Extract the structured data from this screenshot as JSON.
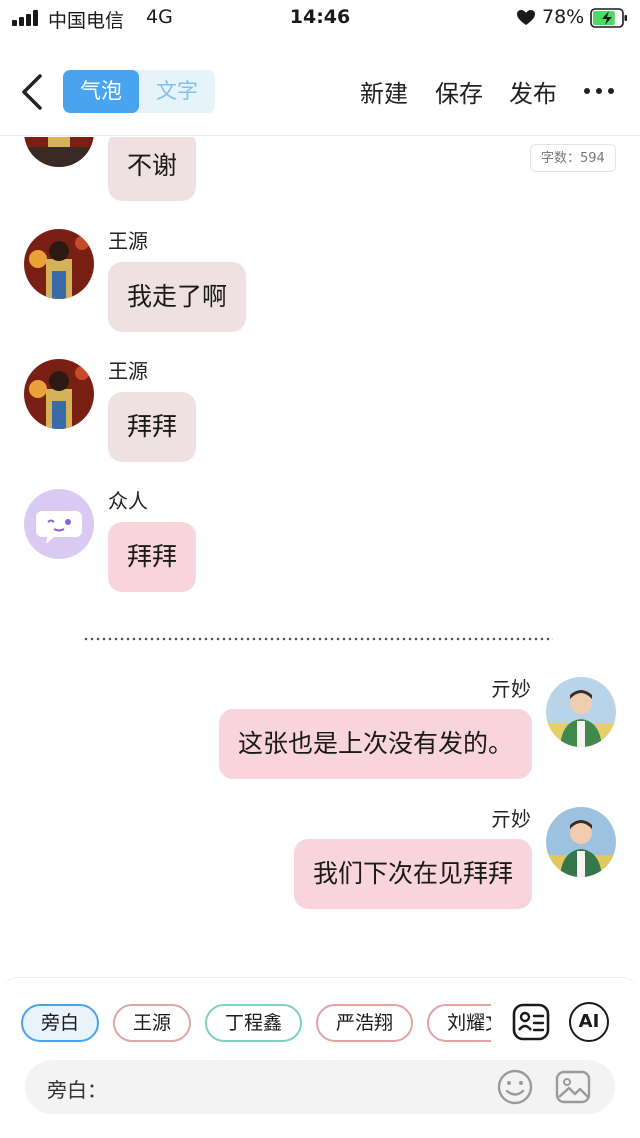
{
  "status": {
    "carrier": "中国电信",
    "network": "4G",
    "time": "14:46",
    "battery_percent": "78%",
    "battery_level": 0.78,
    "icons": [
      "signal-icon",
      "heart-icon",
      "battery-charging-icon"
    ]
  },
  "header": {
    "tabs": [
      {
        "label": "气泡",
        "active": true
      },
      {
        "label": "文字",
        "active": false
      }
    ],
    "actions": {
      "new_label": "新建",
      "save_label": "保存",
      "publish_label": "发布"
    },
    "icons": [
      "chevron-left-icon",
      "more-icon"
    ]
  },
  "chat": {
    "word_count_label": "字数：594",
    "messages": [
      {
        "sender": "",
        "text": "不谢",
        "side": "left",
        "avatar": "photo-person"
      },
      {
        "sender": "王源",
        "text": "我走了啊",
        "side": "left",
        "avatar": "photo-person"
      },
      {
        "sender": "王源",
        "text": "拜拜",
        "side": "left",
        "avatar": "photo-person"
      },
      {
        "sender": "众人",
        "text": "拜拜",
        "side": "left",
        "avatar": "crowd-bubble-icon"
      },
      {
        "sender": "亓妙",
        "text": "这张也是上次没有发的。",
        "side": "right",
        "avatar": "photo-person-green"
      },
      {
        "sender": "亓妙",
        "text": "我们下次在见拜拜",
        "side": "right",
        "avatar": "photo-person-green"
      }
    ]
  },
  "bottom": {
    "chips": [
      {
        "label": "旁白",
        "active": true
      },
      {
        "label": "王源",
        "active": false
      },
      {
        "label": "丁程鑫",
        "active": false
      },
      {
        "label": "严浩翔",
        "active": false
      },
      {
        "label": "刘耀文",
        "active": false
      }
    ],
    "ai_label": "AI",
    "input_label": "旁白：",
    "input_value": "",
    "icons": [
      "contact-card-icon",
      "ai-icon",
      "emoji-icon",
      "image-icon"
    ]
  },
  "colors": {
    "accent": "#4aa3ef",
    "bubble_grey": "#efe1e1",
    "bubble_pink": "#f8d4dc",
    "crowd_avatar": "#d9c9f3"
  }
}
